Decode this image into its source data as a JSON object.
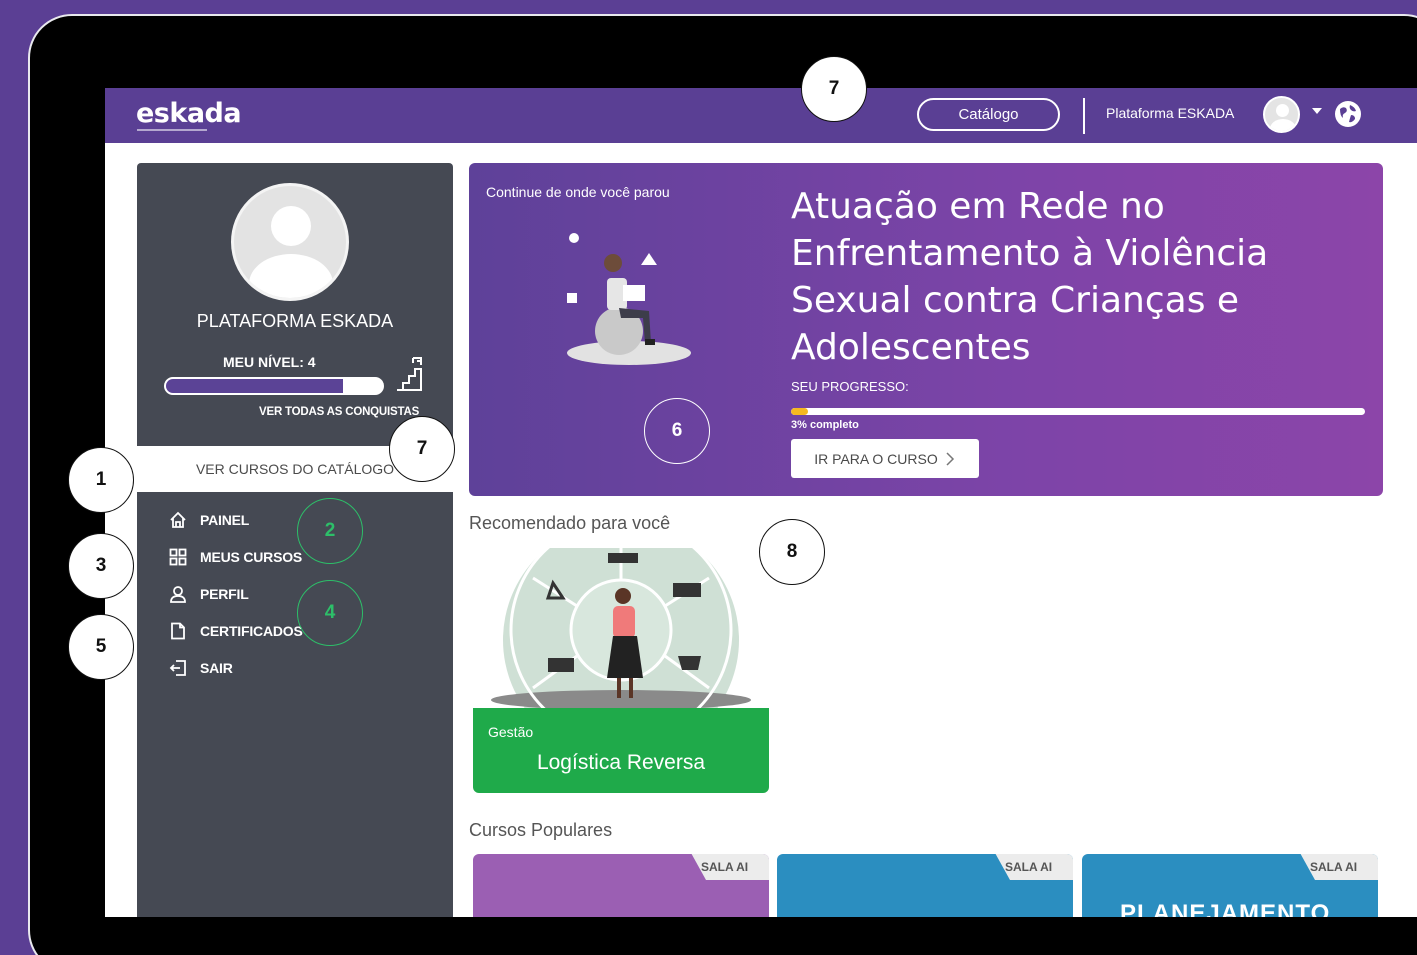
{
  "topbar": {
    "logo": "eskada",
    "catalog_button": "Catálogo",
    "user_name": "Plataforma ESKADA"
  },
  "sidebar": {
    "profile_name": "PLATAFORMA ESKADA",
    "level_label": "MEU NÍVEL: 4",
    "level_progress_pct": 82,
    "achievements_link": "VER TODAS AS CONQUISTAS",
    "catalog_link": "VER CURSOS DO CATÁLOGO",
    "nav": [
      {
        "label": "PAINEL",
        "icon": "home-icon"
      },
      {
        "label": "MEUS CURSOS",
        "icon": "grid-icon"
      },
      {
        "label": "PERFIL",
        "icon": "user-icon"
      },
      {
        "label": "CERTIFICADOS",
        "icon": "document-icon"
      },
      {
        "label": "SAIR",
        "icon": "logout-icon"
      }
    ]
  },
  "hero": {
    "continue_label": "Continue de onde você parou",
    "course_title": "Atuação em Rede no Enfrentamento à Violência Sexual contra Crianças e Adolescentes",
    "progress_label": "SEU PROGRESSO:",
    "progress_pct": 3,
    "progress_text": "3% completo",
    "go_button": "IR PARA O CURSO"
  },
  "recommended": {
    "title": "Recomendado para você",
    "card": {
      "category": "Gestão",
      "title": "Logística Reversa"
    }
  },
  "popular": {
    "title": "Cursos Populares",
    "cards": [
      {
        "tag": "SALA AI",
        "color": "#9b5fb3",
        "text": ""
      },
      {
        "tag": "SALA AI",
        "color": "#2b8ec0",
        "text": ""
      },
      {
        "tag": "SALA AI",
        "color": "#2b8ec0",
        "text": "PLANEJAMENTO"
      }
    ]
  },
  "annotations": {
    "n1": "1",
    "n2": "2",
    "n3": "3",
    "n4": "4",
    "n5": "5",
    "n6": "6",
    "n7a": "7",
    "n7b": "7",
    "n8": "8"
  }
}
